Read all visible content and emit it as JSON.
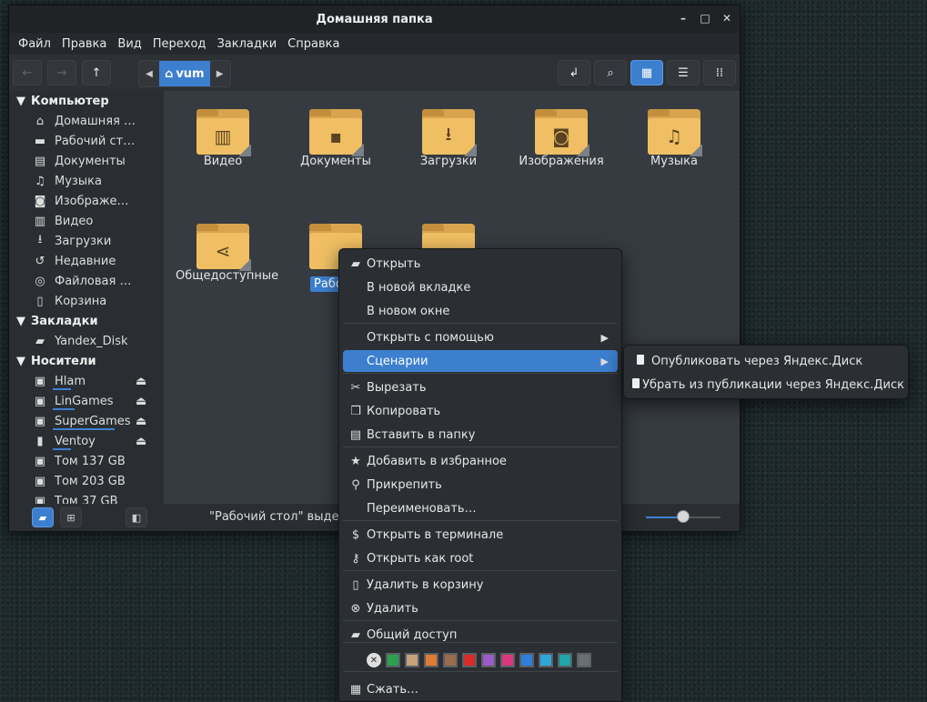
{
  "window": {
    "title": "Домашняя папка",
    "controls": [
      "minimize-icon",
      "maximize-icon",
      "close-icon"
    ]
  },
  "menubar": [
    "Файл",
    "Правка",
    "Вид",
    "Переход",
    "Закладки",
    "Справка"
  ],
  "toolbar": {
    "breadcrumb": "vum",
    "view_mode": "icons"
  },
  "sidebar": {
    "sections": [
      {
        "title": "Компьютер",
        "items": [
          {
            "label": "Домашняя …",
            "icon": "home-icon"
          },
          {
            "label": "Рабочий ст…",
            "icon": "desktop-icon"
          },
          {
            "label": "Документы",
            "icon": "documents-icon"
          },
          {
            "label": "Музыка",
            "icon": "music-icon"
          },
          {
            "label": "Изображе…",
            "icon": "camera-icon"
          },
          {
            "label": "Видео",
            "icon": "film-icon"
          },
          {
            "label": "Загрузки",
            "icon": "download-icon"
          },
          {
            "label": "Недавние",
            "icon": "history-icon"
          },
          {
            "label": "Файловая …",
            "icon": "filesystem-icon"
          },
          {
            "label": "Корзина",
            "icon": "trash-icon"
          }
        ]
      },
      {
        "title": "Закладки",
        "items": [
          {
            "label": "Yandex_Disk",
            "icon": "folder-icon"
          }
        ]
      },
      {
        "title": "Носители",
        "items": [
          {
            "label": "Hlam",
            "icon": "drive-icon",
            "eject": true,
            "usage": 0.25
          },
          {
            "label": "LinGames",
            "icon": "drive-icon",
            "eject": true,
            "usage": 0.3
          },
          {
            "label": "SuperGames",
            "icon": "drive-icon",
            "eject": true,
            "usage": 0.85
          },
          {
            "label": "Ventoy",
            "icon": "usb-icon",
            "eject": true,
            "usage": 0.25
          },
          {
            "label": "Том 137 GB",
            "icon": "drive-icon"
          },
          {
            "label": "Том 203 GB",
            "icon": "drive-icon"
          },
          {
            "label": "Том 37 GB",
            "icon": "drive-icon"
          }
        ]
      }
    ]
  },
  "folders": [
    {
      "label": "Видео",
      "icon": "film-icon"
    },
    {
      "label": "Документы",
      "icon": "document-icon"
    },
    {
      "label": "Загрузки",
      "icon": "download-icon"
    },
    {
      "label": "Изображения",
      "icon": "camera-icon"
    },
    {
      "label": "Музыка",
      "icon": "music-icon"
    },
    {
      "label": "Общедоступные",
      "icon": "share-icon"
    },
    {
      "label": "Рабочи",
      "icon": "",
      "selected": true
    },
    {
      "label": "",
      "icon": "document-icon"
    }
  ],
  "statusbar": {
    "text": "\"Рабочий стол\" выделе",
    "zoom_level": 0.5
  },
  "context_menu": {
    "items": [
      {
        "label": "Открыть",
        "icon": "folder-open-icon"
      },
      {
        "label": "В новой вкладке"
      },
      {
        "label": "В новом окне"
      },
      {
        "label": "Открыть с помощью",
        "submenu": true
      },
      {
        "label": "Сценарии",
        "submenu": true,
        "highlighted": true
      },
      {
        "label": "Вырезать",
        "icon": "scissors-icon"
      },
      {
        "label": "Копировать",
        "icon": "copy-icon"
      },
      {
        "label": "Вставить в папку",
        "icon": "paste-icon"
      },
      {
        "label": "Добавить в избранное",
        "icon": "star-add-icon"
      },
      {
        "label": "Прикрепить",
        "icon": "pin-icon"
      },
      {
        "label": "Переименовать…"
      },
      {
        "label": "Открыть в терминале",
        "icon": "terminal-icon"
      },
      {
        "label": "Открыть как root",
        "icon": "key-icon"
      },
      {
        "label": "Удалить в корзину",
        "icon": "trash-icon"
      },
      {
        "label": "Удалить",
        "icon": "delete-icon"
      },
      {
        "label": "Общий доступ",
        "icon": "folder-share-icon"
      },
      {
        "label": "Сжать…",
        "icon": "archive-icon"
      }
    ],
    "color_tags": [
      "#2e9e4f",
      "#c7a27c",
      "#e07b33",
      "#9c6b4e",
      "#d92b2b",
      "#9a5cc9",
      "#d9387f",
      "#2d7fd9",
      "#2fa6d9",
      "#1fa6a6",
      "#6a6f75"
    ]
  },
  "submenu": {
    "items": [
      "Опубликовать через Яндекс.Диск",
      "Убрать из публикации через Яндекс.Диск"
    ]
  },
  "colors": {
    "accent": "#3d7fcf",
    "folder": "#f0bf63"
  }
}
